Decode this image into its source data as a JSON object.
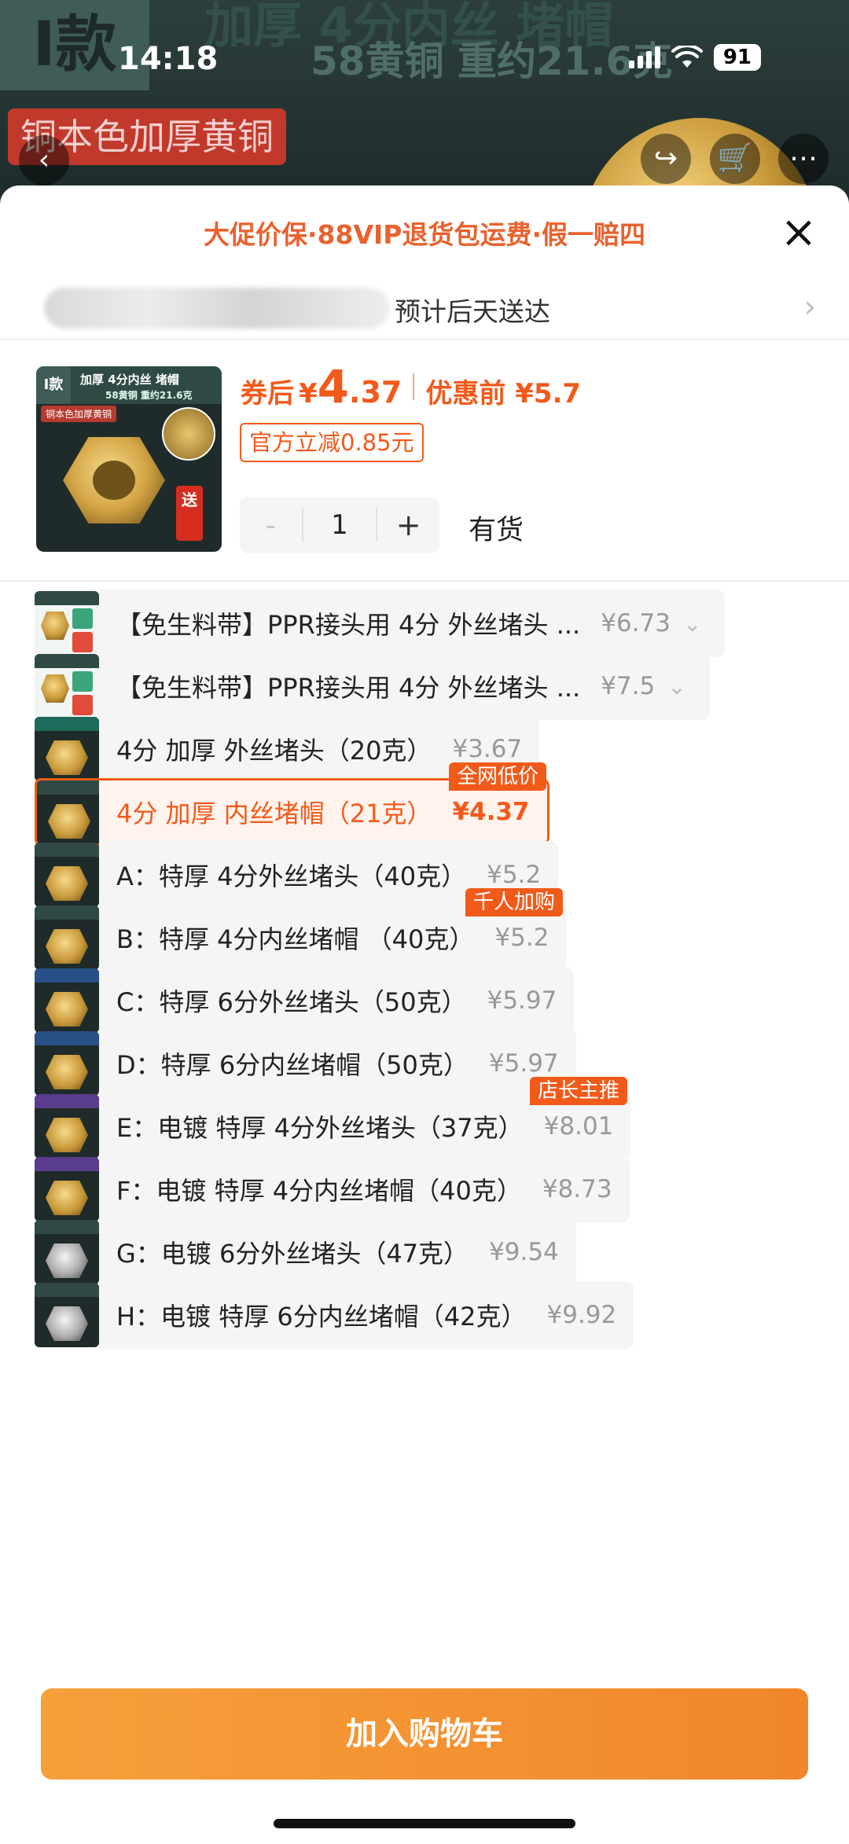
{
  "status_bar": {
    "time": "14:18",
    "battery": "91"
  },
  "hero": {
    "badge": "I款",
    "title": "加厚 4分内丝 堵帽",
    "subtitle": "58黄铜  重约21.6克",
    "red_label": "铜本色加厚黄铜"
  },
  "sheet": {
    "promo": "大促价保·88VIP退货包运费·假一赔四",
    "close_icon": "×",
    "delivery_text": "预计后天送达",
    "delivery_chevron": "›"
  },
  "product": {
    "thumb": {
      "badge": "I款",
      "title": "加厚 4分内丝 堵帽",
      "sub": "58黄铜 重约21.6克",
      "red": "铜本色加厚黄铜",
      "send": "送"
    },
    "price_label": "券后",
    "currency": "¥",
    "price_int": "4",
    "price_dec": ".37",
    "before_label": "优惠前 ¥5.7",
    "discount_tag": "官方立减0.85元",
    "quantity": {
      "minus": "-",
      "value": "1",
      "plus": "+"
    },
    "stock": "有货"
  },
  "variants": [
    {
      "name": "【免生料带】PPR接头用 4分 外丝堵头 ...",
      "price": "¥6.73",
      "chevron": "⌄",
      "thumb": "light",
      "tag": ""
    },
    {
      "name": "【免生料带】PPR接头用 4分 外丝堵头 ...",
      "price": "¥7.5",
      "chevron": "⌄",
      "thumb": "light",
      "tag": ""
    },
    {
      "name": "4分 加厚 外丝堵头（20克）",
      "price": "¥3.67",
      "chevron": "",
      "thumb": "green",
      "tag": ""
    },
    {
      "name": "4分 加厚 内丝堵帽（21克）",
      "price": "¥4.37",
      "chevron": "",
      "thumb": "brass",
      "tag": "全网低价",
      "selected": true
    },
    {
      "name": "A：特厚 4分外丝堵头（40克）",
      "price": "¥5.2",
      "chevron": "",
      "thumb": "brass",
      "tag": ""
    },
    {
      "name": "B：特厚 4分内丝堵帽 （40克）",
      "price": "¥5.2",
      "chevron": "",
      "thumb": "brass",
      "tag": "千人加购"
    },
    {
      "name": "C：特厚 6分外丝堵头（50克）",
      "price": "¥5.97",
      "chevron": "",
      "thumb": "blue",
      "tag": ""
    },
    {
      "name": "D：特厚 6分内丝堵帽（50克）",
      "price": "¥5.97",
      "chevron": "",
      "thumb": "blue",
      "tag": ""
    },
    {
      "name": "E：电镀 特厚 4分外丝堵头（37克）",
      "price": "¥8.01",
      "chevron": "",
      "thumb": "purple",
      "tag": "店长主推"
    },
    {
      "name": "F：电镀 特厚 4分内丝堵帽（40克）",
      "price": "¥8.73",
      "chevron": "",
      "thumb": "purple",
      "tag": ""
    },
    {
      "name": "G：电镀 6分外丝堵头（47克）",
      "price": "¥9.54",
      "chevron": "",
      "thumb": "silver",
      "tag": ""
    },
    {
      "name": "H：电镀 特厚 6分内丝堵帽（42克）",
      "price": "¥9.92",
      "chevron": "",
      "thumb": "silver",
      "tag": ""
    }
  ],
  "actions": {
    "add_to_cart": "加入购物车"
  },
  "colors": {
    "accent": "#f25a1a",
    "button": "#f1862b"
  }
}
